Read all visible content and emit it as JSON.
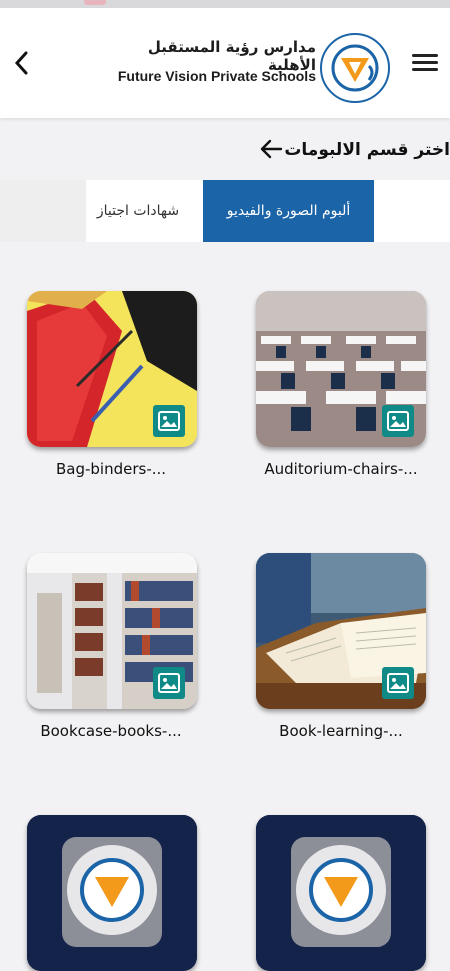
{
  "header": {
    "brand_ar": "مدارس رؤية المستقبل الأهلية",
    "brand_en": "Future Vision Private Schools",
    "logo_ring_text": "مدارس رؤية المستقبل الأهلية FUTURE VISION PRIVATE SCHOOLS"
  },
  "section": {
    "title": "اختر قسم الالبومات"
  },
  "tabs": [
    {
      "label": "ألبوم الصورة والفيديو",
      "active": true
    },
    {
      "label": "شهادات اجتياز",
      "active": false
    }
  ],
  "albums": [
    {
      "caption": "Bag-binders-...",
      "icon": "image-icon"
    },
    {
      "caption": "Auditorium-chairs-...",
      "icon": "image-icon"
    },
    {
      "caption": "Bookcase-books-...",
      "icon": "image-icon"
    },
    {
      "caption": "Book-learning-...",
      "icon": "image-icon"
    },
    {
      "caption": "",
      "icon": "school-logo"
    },
    {
      "caption": "",
      "icon": "school-logo"
    }
  ],
  "colors": {
    "accent": "#1b64a7",
    "badge": "#0f8a86",
    "logo_card": "#13234a",
    "logo_orange": "#f39a1b"
  }
}
